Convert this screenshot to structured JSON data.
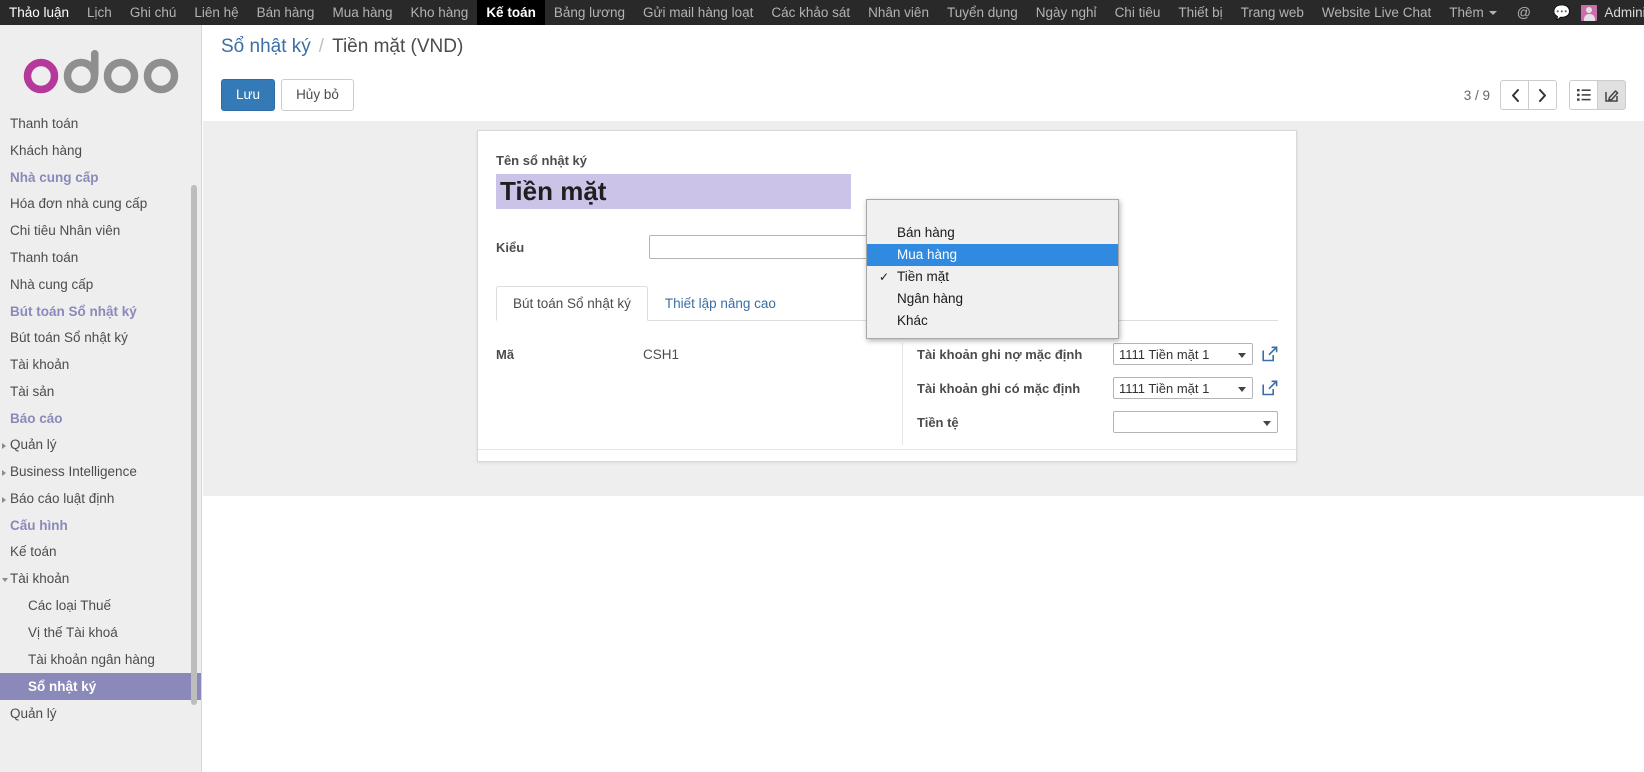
{
  "topbar": {
    "menu_items": [
      {
        "label": "Thảo luận",
        "active": false
      },
      {
        "label": "Lịch",
        "active": false
      },
      {
        "label": "Ghi chú",
        "active": false
      },
      {
        "label": "Liên hệ",
        "active": false
      },
      {
        "label": "Bán hàng",
        "active": false
      },
      {
        "label": "Mua hàng",
        "active": false
      },
      {
        "label": "Kho hàng",
        "active": false
      },
      {
        "label": "Kế toán",
        "active": true
      },
      {
        "label": "Bảng lương",
        "active": false
      },
      {
        "label": "Gửi mail hàng loạt",
        "active": false
      },
      {
        "label": "Các khảo sát",
        "active": false
      },
      {
        "label": "Nhân viên",
        "active": false
      },
      {
        "label": "Tuyển dụng",
        "active": false
      },
      {
        "label": "Ngày nghỉ",
        "active": false
      },
      {
        "label": "Chi tiêu",
        "active": false
      },
      {
        "label": "Thiết bị",
        "active": false
      },
      {
        "label": "Trang web",
        "active": false
      },
      {
        "label": "Website Live Chat",
        "active": false
      },
      {
        "label": "Thêm",
        "active": false,
        "caret": true
      }
    ],
    "mention_icon": "at-icon",
    "messages_icon": "chat-bubble-icon",
    "username": "Administrator",
    "avatar": "user-avatar"
  },
  "sidebar": {
    "logo_text": "odoo",
    "logo_accent_color": "#b5399a",
    "logo_gray_color": "#8f8f8f",
    "items": [
      {
        "label": "Thanh toán",
        "type": "link",
        "indent": 1
      },
      {
        "label": "Khách hàng",
        "type": "link",
        "indent": 1
      },
      {
        "label": "Nhà cung cấp",
        "type": "section"
      },
      {
        "label": "Hóa đơn nhà cung cấp",
        "type": "link",
        "indent": 1
      },
      {
        "label": "Chi tiêu Nhân viên",
        "type": "link",
        "indent": 1
      },
      {
        "label": "Thanh toán",
        "type": "link",
        "indent": 1
      },
      {
        "label": "Nhà cung cấp",
        "type": "link",
        "indent": 1
      },
      {
        "label": "Bút toán Sổ nhật ký",
        "type": "section"
      },
      {
        "label": "Bút toán Sổ nhật ký",
        "type": "link",
        "indent": 1
      },
      {
        "label": "Tài khoản",
        "type": "link",
        "indent": 1
      },
      {
        "label": "Tài sản",
        "type": "link",
        "indent": 1
      },
      {
        "label": "Báo cáo",
        "type": "section"
      },
      {
        "label": "Quản lý",
        "type": "link",
        "indent": 1,
        "caret": true
      },
      {
        "label": "Business Intelligence",
        "type": "link",
        "indent": 1,
        "caret": true
      },
      {
        "label": "Báo cáo luật định",
        "type": "link",
        "indent": 1,
        "caret": true
      },
      {
        "label": "Cấu hình",
        "type": "section"
      },
      {
        "label": "Kế toán",
        "type": "link",
        "indent": 1
      },
      {
        "label": "Tài khoản",
        "type": "link",
        "indent": 1,
        "caret": true,
        "expanded": true
      },
      {
        "label": "Các loại Thuế",
        "type": "link",
        "indent": 2
      },
      {
        "label": "Vị thế Tài khoá",
        "type": "link",
        "indent": 2
      },
      {
        "label": "Tài khoản ngân hàng",
        "type": "link",
        "indent": 2
      },
      {
        "label": "Sổ nhật ký",
        "type": "link",
        "indent": 2,
        "selected": true
      },
      {
        "label": "Quản lý",
        "type": "link",
        "indent": 1
      }
    ]
  },
  "breadcrumb": {
    "parent": "Sổ nhật ký",
    "separator": "/",
    "current": "Tiền mặt (VND)"
  },
  "controls": {
    "save_label": "Lưu",
    "discard_label": "Hủy bỏ",
    "pager_text": "3 / 9",
    "prev_icon": "chevron-left-icon",
    "next_icon": "chevron-right-icon",
    "list_view_icon": "list-view-icon",
    "form_view_icon": "form-view-icon"
  },
  "form": {
    "title_label": "Tên sổ nhật ký",
    "title_value": "Tiền mặt",
    "type_label": "Kiểu",
    "type_value": "Tiền mặt",
    "tabs": [
      {
        "label": "Bút toán Sổ nhật ký",
        "active": true
      },
      {
        "label": "Thiết lập nâng cao",
        "active": false
      }
    ],
    "code_label": "Mã",
    "code_value": "CSH1",
    "debit_label": "Tài khoản ghi nợ mặc định",
    "debit_value": "1111 Tiền mặt 1",
    "credit_label": "Tài khoản ghi có mặc định",
    "credit_value": "1111 Tiền mặt 1",
    "currency_label": "Tiền tệ",
    "currency_value": "",
    "external_link_icon": "external-link-icon"
  },
  "dropdown": {
    "options": [
      {
        "label": "Bán hàng",
        "highlight": false,
        "checked": false
      },
      {
        "label": "Mua hàng",
        "highlight": true,
        "checked": false
      },
      {
        "label": "Tiền mặt",
        "highlight": false,
        "checked": true
      },
      {
        "label": "Ngân hàng",
        "highlight": false,
        "checked": false
      },
      {
        "label": "Khác",
        "highlight": false,
        "checked": false
      }
    ]
  }
}
